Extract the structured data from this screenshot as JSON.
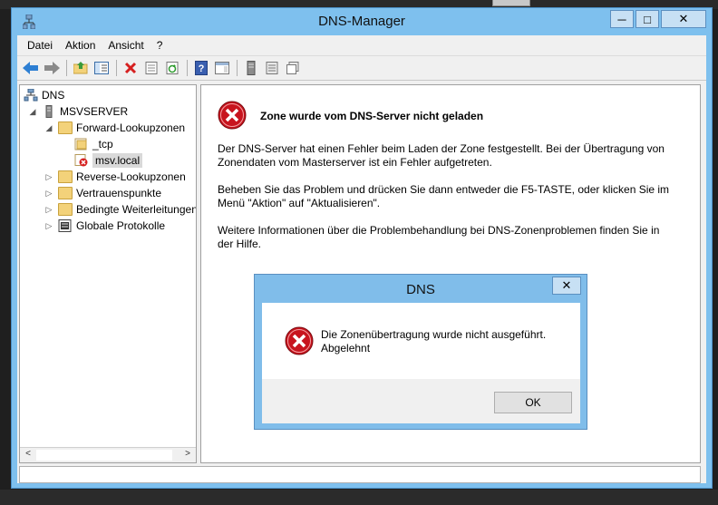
{
  "window": {
    "title": "DNS-Manager",
    "minimize": "─",
    "maximize": "□",
    "close": "✕"
  },
  "menu": [
    "Datei",
    "Aktion",
    "Ansicht",
    "?"
  ],
  "toolbar_icons": [
    "back-arrow-icon",
    "forward-arrow-icon",
    "up-folder-icon",
    "show-hide-tree-icon",
    "delete-icon",
    "properties-icon",
    "refresh-icon",
    "help-icon",
    "action-pane-icon",
    "server-icon",
    "zone-list-icon",
    "zone-copy-icon"
  ],
  "tree": {
    "root": "DNS",
    "server": "MSVSERVER",
    "forward": "Forward-Lookupzonen",
    "tcp": "_tcp",
    "zone": "msv.local",
    "reverse": "Reverse-Lookupzonen",
    "trust": "Vertrauenspunkte",
    "conditional": "Bedingte Weiterleitungen",
    "logs": "Globale Protokolle"
  },
  "content": {
    "heading": "Zone wurde vom DNS-Server nicht geladen",
    "p1_line1": "Der DNS-Server hat einen Fehler beim Laden der Zone festgestellt. Bei der Übertragung von",
    "p1_line2": "Zonendaten vom Masterserver ist ein Fehler aufgetreten.",
    "p2_line1": "Beheben Sie das Problem und drücken Sie dann entweder die F5-TASTE, oder klicken Sie im",
    "p2_line2": "Menü \"Aktion\" auf \"Aktualisieren\".",
    "p3_line1": "Weitere Informationen über die Problembehandlung bei DNS-Zonenproblemen finden Sie in",
    "p3_line2": "der Hilfe."
  },
  "dialog": {
    "title": "DNS",
    "close": "✕",
    "message_line1": "Die Zonenübertragung wurde nicht ausgeführt.",
    "message_line2": "Abgelehnt",
    "ok": "OK"
  },
  "scroll": {
    "left": "<",
    "right": ">"
  }
}
